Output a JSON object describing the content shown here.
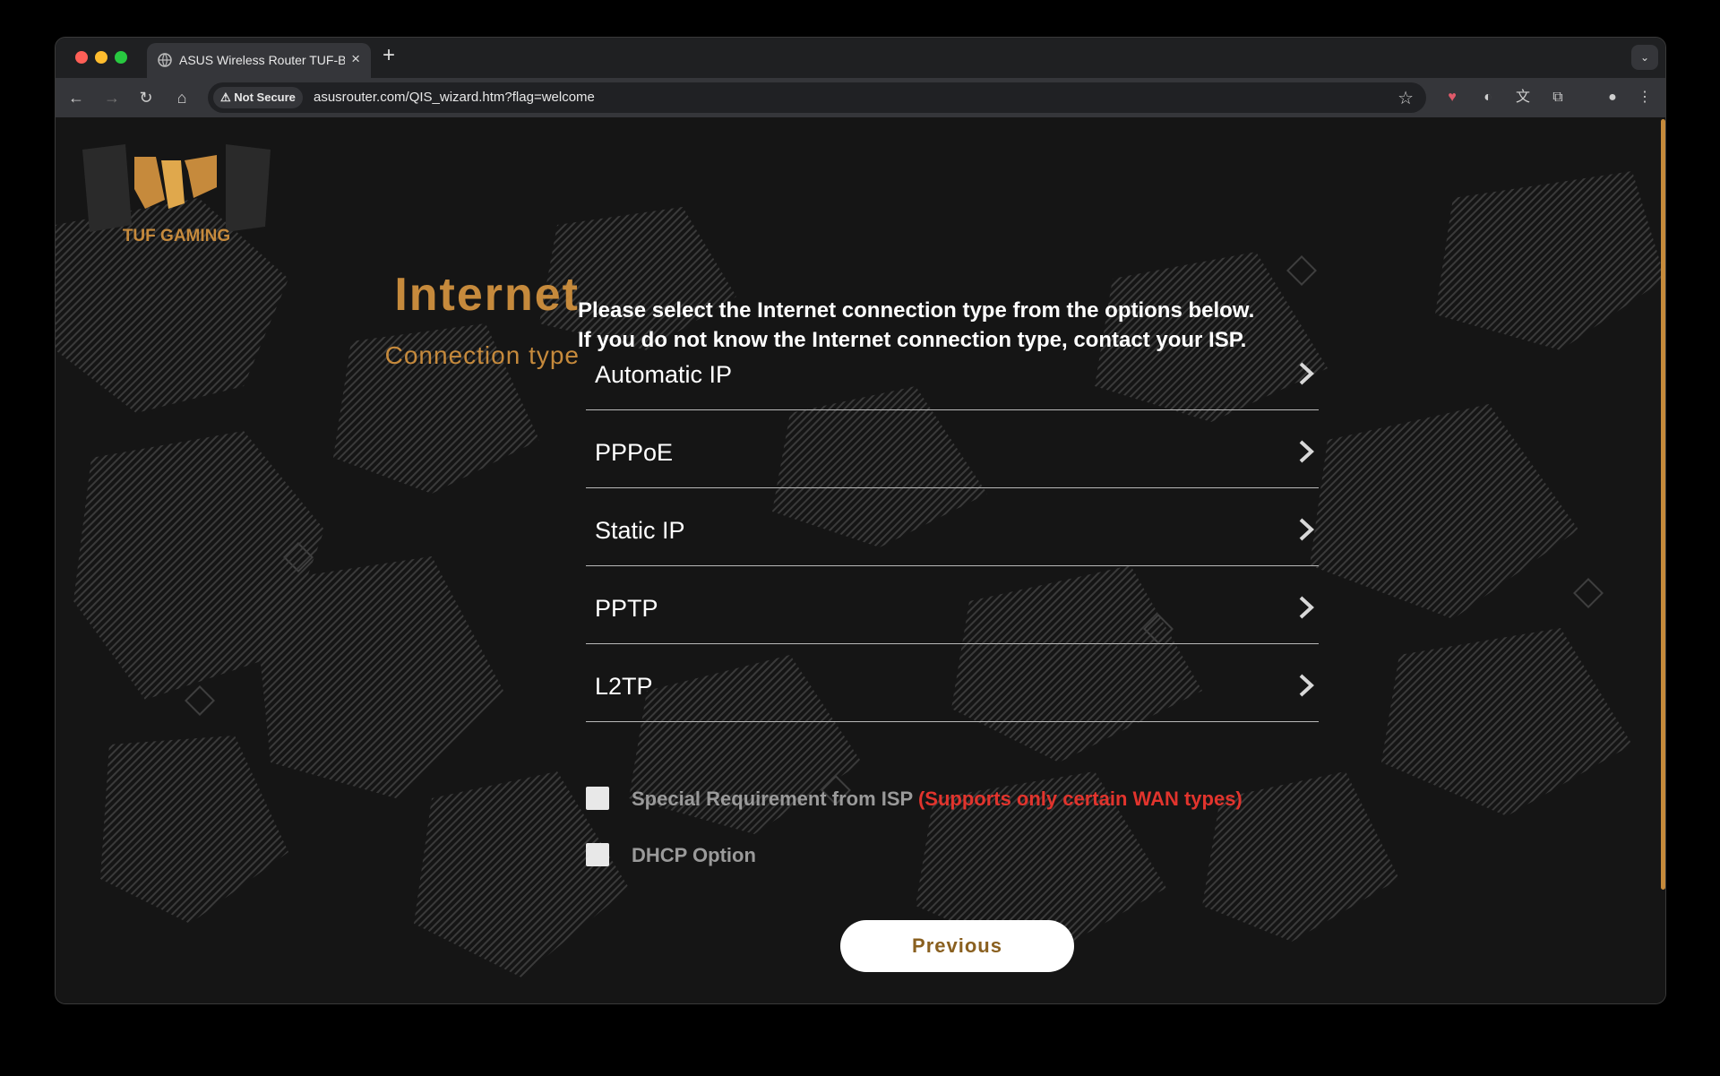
{
  "browser": {
    "tab_title": "ASUS Wireless Router TUF-B",
    "security_label": "Not Secure",
    "url": "asusrouter.com/QIS_wizard.htm?flag=welcome"
  },
  "page": {
    "logo_text": "TUF GAMING",
    "title_main": "Internet",
    "title_sub": "Connection type",
    "intro_line1": "Please select the Internet connection type from the options below.",
    "intro_line2": "If you do not know the Internet connection type, contact your ISP.",
    "options": [
      {
        "label": "Automatic IP"
      },
      {
        "label": "PPPoE"
      },
      {
        "label": "Static IP"
      },
      {
        "label": "PPTP"
      },
      {
        "label": "L2TP"
      }
    ],
    "special_requirement_label": "Special Requirement from ISP",
    "special_requirement_note": "(Supports only certain WAN types)",
    "dhcp_option_label": "DHCP Option",
    "previous_button": "Previous"
  },
  "colors": {
    "accent": "#c68a3c",
    "warning_text": "#e2342d",
    "background": "#151515"
  }
}
